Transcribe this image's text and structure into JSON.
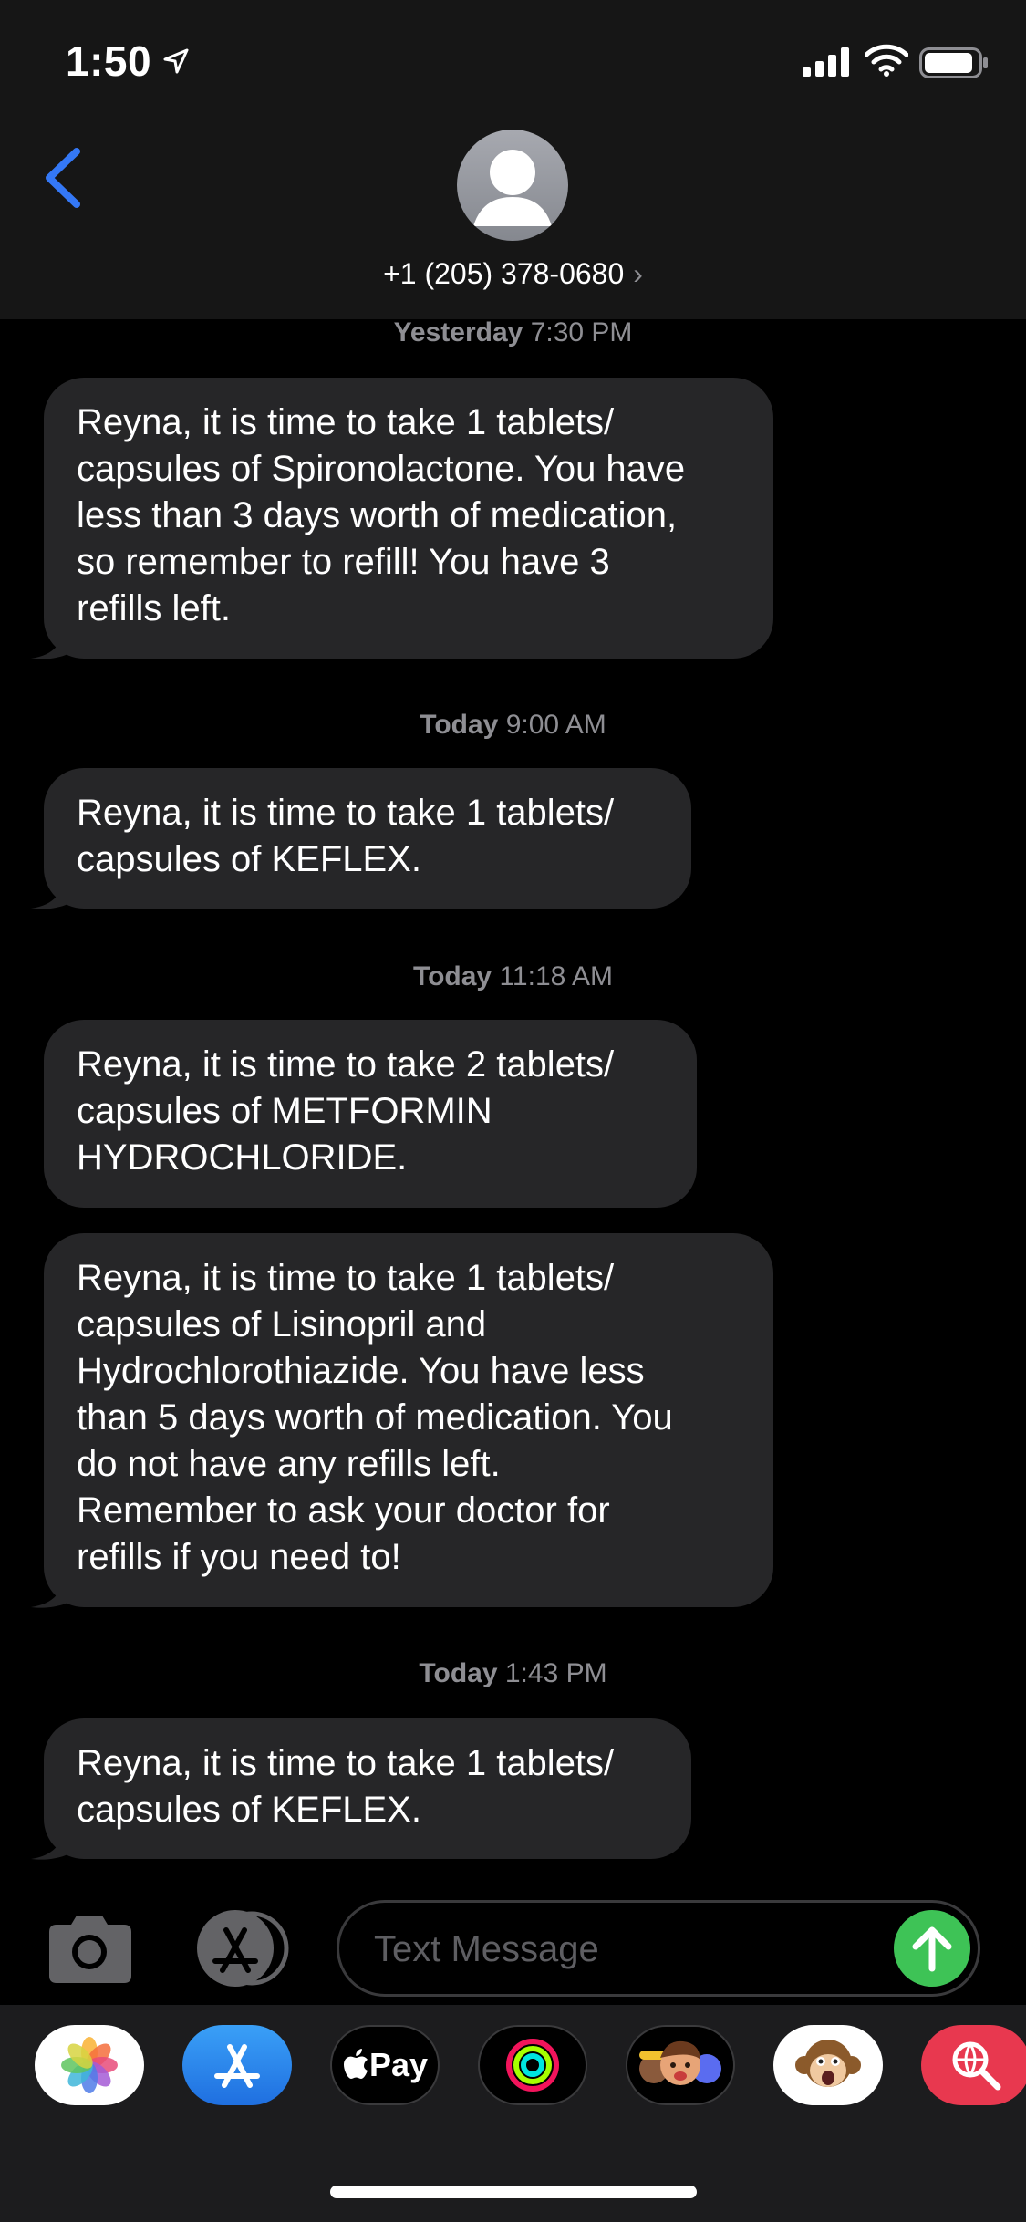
{
  "status_bar": {
    "time": "1:50"
  },
  "contact": {
    "name": "+1 (205) 378-0680",
    "chevron": "›"
  },
  "messages": [
    {
      "stamp_day": "Yesterday",
      "stamp_time": "7:30 PM",
      "lines": [
        "Reyna, it is time to take 1 tablets/",
        "capsules of Spironolactone. You have",
        "less than 3 days worth of medication,",
        "so remember to refill! You have 3",
        "refills left."
      ]
    },
    {
      "stamp_day": "Today",
      "stamp_time": "9:00 AM",
      "lines": [
        "Reyna, it is time to take 1 tablets/",
        "capsules of KEFLEX."
      ]
    },
    {
      "stamp_day": "Today",
      "stamp_time": "11:18 AM",
      "lines": [
        "Reyna, it is time to take 2 tablets/",
        "capsules of METFORMIN",
        "HYDROCHLORIDE."
      ]
    },
    {
      "lines": [
        "Reyna, it is time to take 1 tablets/",
        "capsules of Lisinopril and",
        "Hydrochlorothiazide. You have less",
        "than 5 days worth of medication. You",
        "do not have any refills left.",
        "Remember to ask your doctor for",
        "refills if you need to!"
      ]
    },
    {
      "stamp_day": "Today",
      "stamp_time": "1:43 PM",
      "lines": [
        "Reyna, it is time to take 1 tablets/",
        "capsules of KEFLEX."
      ]
    }
  ],
  "composer": {
    "placeholder": "Text Message"
  },
  "app_drawer": {
    "apps": [
      {
        "name": "photos-app-icon"
      },
      {
        "name": "app-store-app-icon"
      },
      {
        "name": "apple-pay-app-icon",
        "label": "Pay"
      },
      {
        "name": "activity-app-icon"
      },
      {
        "name": "memoji-app-icon"
      },
      {
        "name": "animoji-app-icon"
      },
      {
        "name": "web-search-app-icon"
      }
    ]
  },
  "colors": {
    "bubble": "#262628",
    "header": "#161616",
    "accent_blue": "#3478f6",
    "send_green": "#3ec356",
    "stamp_gray": "#8e8e93"
  }
}
